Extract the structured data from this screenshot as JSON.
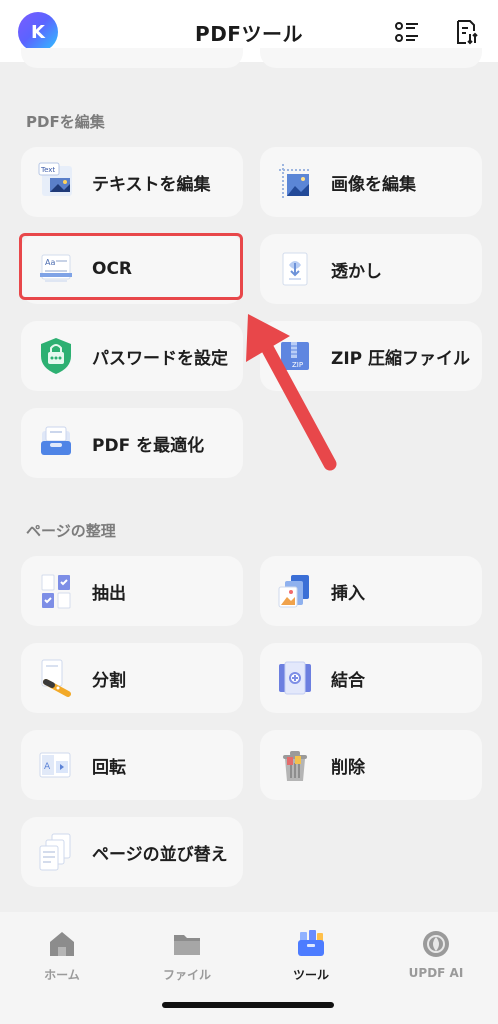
{
  "header": {
    "title": "PDFツール",
    "avatar_initial": "K"
  },
  "sections": {
    "edit_title": "PDFを編集",
    "organize_title": "ページの整理"
  },
  "edit_tools": {
    "edit_text": "テキストを編集",
    "edit_image": "画像を編集",
    "ocr": "OCR",
    "watermark": "透かし",
    "set_password": "パスワードを設定",
    "zip": "ZIP 圧縮ファイル",
    "optimize": "PDF を最適化"
  },
  "page_tools": {
    "extract": "抽出",
    "insert": "挿入",
    "split": "分割",
    "merge": "結合",
    "rotate": "回転",
    "delete": "削除",
    "reorder": "ページの並び替え"
  },
  "tabbar": {
    "home": "ホーム",
    "files": "ファイル",
    "tools": "ツール",
    "ai": "UPDF AI"
  },
  "icon_text": {
    "text_tag": "Text",
    "ocr_tag": "Aa",
    "zip_tag": "ZIP",
    "rotate_tag": "A"
  },
  "colors": {
    "highlight": "#e8474a",
    "accent": "#4d7cff"
  }
}
